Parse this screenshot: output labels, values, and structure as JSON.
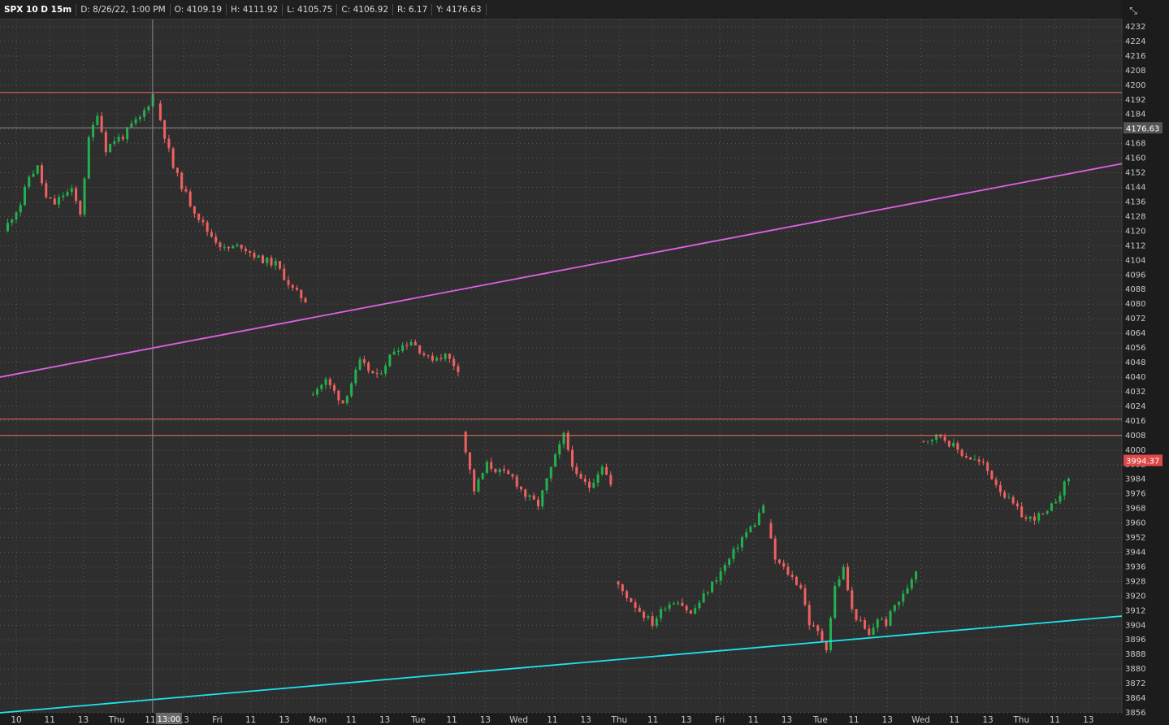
{
  "header": {
    "symbol": "SPX 10 D 15m",
    "date": "D: 8/26/22, 1:00 PM",
    "open": "O: 4109.19",
    "high": "H: 4111.92",
    "low": "L: 4105.75",
    "close": "C: 4106.92",
    "range": "R: 6.17",
    "yvalue": "Y: 4176.63"
  },
  "close_icon_glyph": "⤡",
  "colors": {
    "background": "#2e2e2e",
    "up_candle": "#22b14c",
    "down_candle": "#f06060",
    "resistance_lines": "#f06a55",
    "upper_trendline": "#e060e6",
    "lower_trendline": "#1ee4ee",
    "grid": "#5a5a5a",
    "crosshair": "#8a8a8a"
  },
  "chart_data": {
    "type": "candlestick",
    "instrument": "SPX",
    "interval": "15m",
    "ylim": [
      3856,
      4236
    ],
    "y_ticks": [
      4232,
      4224,
      4216,
      4208,
      4200,
      4192,
      4184,
      4176,
      4168,
      4160,
      4152,
      4144,
      4136,
      4128,
      4120,
      4112,
      4104,
      4096,
      4088,
      4080,
      4072,
      4064,
      4056,
      4048,
      4040,
      4032,
      4024,
      4016,
      4008,
      4000,
      3992,
      3984,
      3976,
      3968,
      3960,
      3952,
      3944,
      3936,
      3928,
      3920,
      3912,
      3904,
      3896,
      3888,
      3880,
      3872,
      3864,
      3856
    ],
    "x_labels": [
      "10",
      "11",
      "13",
      "Thu",
      "11",
      "13",
      "Fri",
      "11",
      "13",
      "Mon",
      "11",
      "13",
      "Tue",
      "11",
      "13",
      "Wed",
      "11",
      "13",
      "Thu",
      "11",
      "13",
      "Fri",
      "11",
      "13",
      "Tue",
      "11",
      "13",
      "Wed",
      "11",
      "13",
      "Thu",
      "11",
      "13"
    ],
    "crosshair_time_label": "13:00",
    "crosshair_price": 4176.63,
    "last_price": 3994.37,
    "horizontal_lines": [
      4196,
      4017,
      4008
    ],
    "trendlines": [
      {
        "name": "upper",
        "from": 4040,
        "to": 4157
      },
      {
        "name": "lower",
        "from": 3856,
        "to": 3909
      }
    ],
    "session_closes": [
      [
        4120,
        4128,
        4135,
        4150,
        4155,
        4138,
        4135,
        4140,
        4142,
        4130,
        4170,
        4185,
        4165,
        4170,
        4172,
        4178,
        4182,
        4190,
        4200,
        4198
      ],
      [
        4190,
        4155,
        4135,
        4120,
        4110,
        4112,
        4105,
        4102,
        4088,
        4080,
        4068
      ],
      [
        4030,
        4038,
        4026,
        4048,
        4040,
        4055,
        4060,
        4050,
        4052,
        4042
      ],
      [
        4010,
        3978,
        3992,
        3988,
        3985,
        3975,
        3970,
        3990,
        4008,
        3985,
        3980,
        3992,
        3975,
        3968,
        3965,
        3958,
        3975,
        3960
      ],
      [
        3928,
        3920,
        3912,
        3905,
        3915,
        3918,
        3910,
        3920,
        3930,
        3940,
        3952,
        3960,
        3975,
        4000,
        4016,
        4010,
        4010,
        3980
      ],
      [
        3960,
        3940,
        3935,
        3930,
        3925,
        3905,
        3900,
        3892,
        3925,
        3935,
        3912,
        3905,
        3898,
        3908,
        3905,
        3915,
        3920,
        3930,
        3940,
        3945,
        3955,
        3960,
        3975,
        3990
      ],
      [
        4005,
        4008,
        3998,
        3992,
        3975,
        3962,
        3965,
        3985,
        3994
      ]
    ]
  }
}
